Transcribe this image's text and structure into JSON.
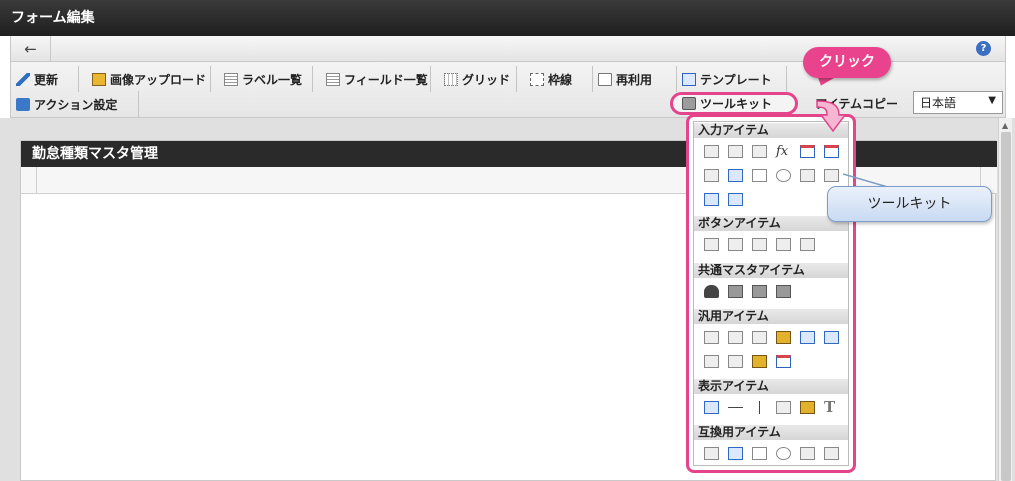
{
  "window": {
    "title": "フォーム編集"
  },
  "toolbar": {
    "buttons": [
      {
        "label": "更新",
        "icon": "pencil-icon"
      },
      {
        "label": "画像アップロード",
        "icon": "image-upload-icon"
      },
      {
        "label": "ラベル一覧",
        "icon": "list-icon"
      },
      {
        "label": "フィールド一覧",
        "icon": "list-icon"
      },
      {
        "label": "グリッド",
        "icon": "grid-icon"
      },
      {
        "label": "枠線",
        "icon": "frame-icon"
      },
      {
        "label": "再利用",
        "icon": "document-icon"
      },
      {
        "label": "テンプレート",
        "icon": "template-icon"
      },
      {
        "label": "アクション設定",
        "icon": "action-icon"
      }
    ],
    "toolkit_button": "ツールキット",
    "item_copy_button": "アイテムコピー",
    "language": {
      "selected": "日本語"
    }
  },
  "form": {
    "title": "勤怠種類マスタ管理"
  },
  "annotations": {
    "click_bubble": "クリック",
    "callout": "ツールキット"
  },
  "palette": {
    "sections": [
      {
        "title": "入力アイテム"
      },
      {
        "title": "ボタンアイテム"
      },
      {
        "title": "共通マスタアイテム"
      },
      {
        "title": "汎用アイテム"
      },
      {
        "title": "表示アイテム"
      },
      {
        "title": "互換用アイテム"
      }
    ]
  },
  "colors": {
    "highlight": "#e4448a",
    "title_bar": "#2a2a2a",
    "callout_bg": "#c9daf3"
  }
}
